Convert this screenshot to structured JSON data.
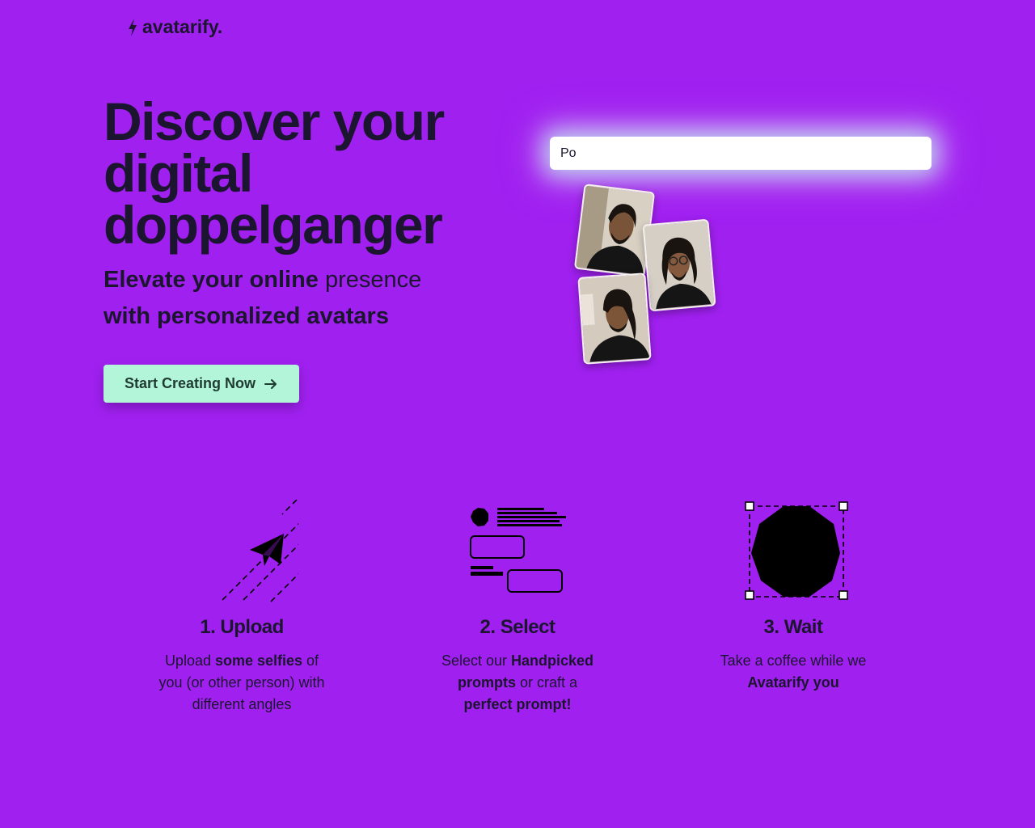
{
  "brand": {
    "name": "avatarify."
  },
  "hero": {
    "title": "Discover your digital doppelganger",
    "subtitle": {
      "part1": "Elevate your online",
      "part2": "presence",
      "part3": "with personalized avatars"
    },
    "cta_label": "Start Creating Now"
  },
  "prompt": {
    "value": "Po"
  },
  "steps": [
    {
      "title": "1. Upload",
      "desc": {
        "a": "Upload ",
        "b": "some selfies",
        "c": " of you (or other person) with different angles"
      }
    },
    {
      "title": "2. Select",
      "desc": {
        "a": "Select our ",
        "b": "Handpicked prompts",
        "c": " or craft a ",
        "d": "perfect prompt!"
      }
    },
    {
      "title": "3. Wait",
      "desc": {
        "a": "Take a coffee while we ",
        "b": "Avatarify you"
      }
    }
  ],
  "colors": {
    "background": "#a020f0",
    "text": "#1c1530",
    "cta": "#b3f5d8"
  }
}
